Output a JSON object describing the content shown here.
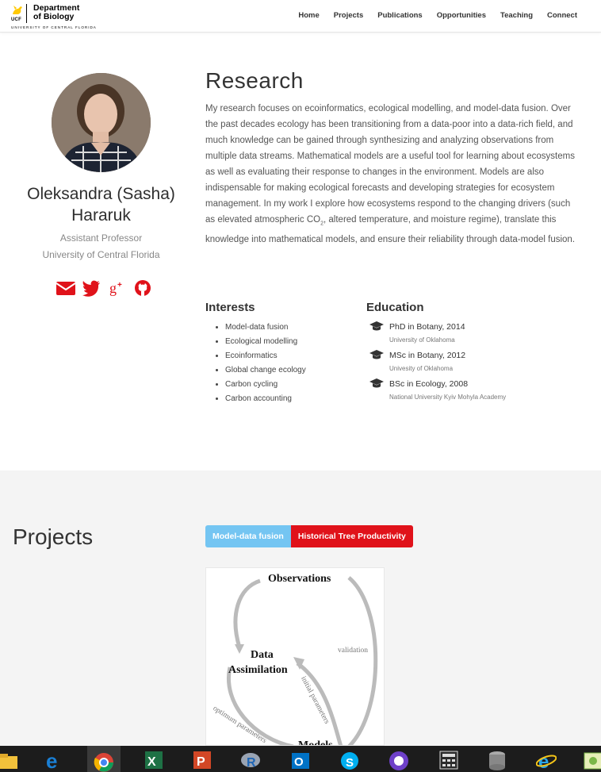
{
  "nav": {
    "logo_ucf": "UCF",
    "logo_dept_line1": "Department",
    "logo_dept_line2": "of Biology",
    "logo_university": "UNIVERSITY OF CENTRAL FLORIDA",
    "links": [
      "Home",
      "Projects",
      "Publications",
      "Opportunities",
      "Teaching",
      "Connect"
    ]
  },
  "profile": {
    "name": "Oleksandra (Sasha) Hararuk",
    "position": "Assistant Professor",
    "affiliation": "University of Central Florida",
    "socials": [
      "envelope-icon",
      "twitter-icon",
      "google-plus-icon",
      "github-icon"
    ]
  },
  "research": {
    "heading": "Research",
    "text_part1": "My research focuses on ecoinformatics, ecological modelling, and model-data fusion. Over the past decades ecology has been transitioning from a data-poor into a data-rich field, and much knowledge can be gained through synthesizing and analyzing observations from multiple data streams. Mathematical models are a useful tool for learning about ecosystems as well as evaluating their response to changes in the environment. Models are also indispensable for making ecological forecasts and developing strategies for ecosystem management. In my work I explore how ecosystems respond to the changing drivers (such as elevated atmospheric CO",
    "text_sub": "2",
    "text_part2": ", altered temperature, and moisture regime), translate this knowledge into mathematical models, and ensure their reliability through data-model fusion."
  },
  "interests": {
    "heading": "Interests",
    "items": [
      "Model-data fusion",
      "Ecological modelling",
      "Ecoinformatics",
      "Global change ecology",
      "Carbon cycling",
      "Carbon accounting"
    ]
  },
  "education": {
    "heading": "Education",
    "items": [
      {
        "degree": "PhD in Botany, 2014",
        "institution": "University of Oklahoma"
      },
      {
        "degree": "MSc in Botany, 2012",
        "institution": "Univesity of Oklahoma"
      },
      {
        "degree": "BSc in Ecology, 2008",
        "institution": "National University Kyiv Mohyla Academy"
      }
    ]
  },
  "projects": {
    "heading": "Projects",
    "tabs": [
      "Model-data fusion",
      "Historical Tree Productivity"
    ],
    "diagram": {
      "observations": "Observations",
      "data": "Data",
      "assimilation": "Assimilation",
      "validation": "validation",
      "initial_parameters": "initial parameters",
      "optimum_parameters": "optimum parameters",
      "models": "Models"
    }
  },
  "taskbar": {
    "icons": [
      "file-explorer-icon",
      "edge-icon",
      "chrome-icon",
      "excel-icon",
      "powerpoint-icon",
      "r-icon",
      "outlook-icon",
      "skype-icon",
      "github-desktop-icon",
      "calculator-icon",
      "database-icon",
      "internet-explorer-icon",
      "photos-icon"
    ]
  },
  "colors": {
    "accent_red": "#e0121a",
    "tab_blue": "#74c5f2"
  }
}
